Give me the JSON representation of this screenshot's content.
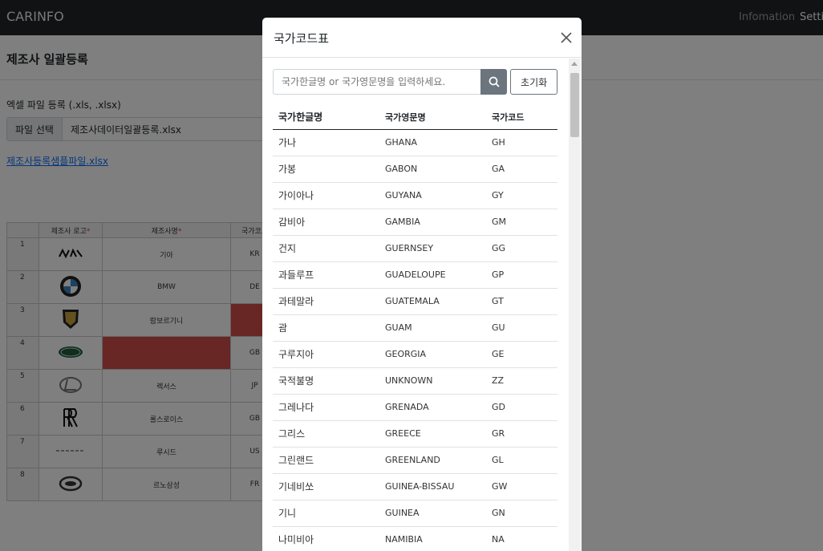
{
  "navbar": {
    "brand": "CARINFO",
    "links": [
      "Infomation",
      "Setti"
    ]
  },
  "page": {
    "title": "제조사 일괄등록",
    "file_label": "엑셀 파일 등록 (.xls, .xlsx)",
    "file_button": "파일 선택",
    "file_name": "제조사데이터일괄등록.xlsx",
    "sample_link": "제조사등록샘플파일.xlsx"
  },
  "grid": {
    "headers": [
      "제조사 로고",
      "제조사명",
      "국가코드"
    ],
    "required_mark": "*",
    "rows": [
      {
        "num": "1",
        "logo": "kia-logo",
        "name": "기아",
        "code": "KR"
      },
      {
        "num": "2",
        "logo": "bmw-logo",
        "name": "BMW",
        "code": "DE"
      },
      {
        "num": "3",
        "logo": "lamborghini-logo",
        "name": "람보르기니",
        "code": ""
      },
      {
        "num": "4",
        "logo": "land-rover-logo",
        "name": "",
        "code": "GB"
      },
      {
        "num": "5",
        "logo": "lexus-logo",
        "name": "렉서스",
        "code": "JP"
      },
      {
        "num": "6",
        "logo": "rolls-royce-logo",
        "name": "롤스로이스",
        "code": "GB"
      },
      {
        "num": "7",
        "logo": "lucid-logo",
        "name": "루시드",
        "code": "US"
      },
      {
        "num": "8",
        "logo": "renault-samsung-logo",
        "name": "르노삼성",
        "code": "FR"
      }
    ],
    "error_color": "#d14d4a"
  },
  "modal": {
    "title": "국가코드표",
    "search_placeholder": "국가한글명 or 국가영문명을 입력하세요.",
    "reset_label": "초기화",
    "columns": [
      "국가한글명",
      "국가영문명",
      "국가코드"
    ],
    "rows": [
      [
        "가나",
        "GHANA",
        "GH"
      ],
      [
        "가봉",
        "GABON",
        "GA"
      ],
      [
        "가이아나",
        "GUYANA",
        "GY"
      ],
      [
        "감비아",
        "GAMBIA",
        "GM"
      ],
      [
        "건지",
        "GUERNSEY",
        "GG"
      ],
      [
        "과들루프",
        "GUADELOUPE",
        "GP"
      ],
      [
        "과테말라",
        "GUATEMALA",
        "GT"
      ],
      [
        "괌",
        "GUAM",
        "GU"
      ],
      [
        "구루지아",
        "GEORGIA",
        "GE"
      ],
      [
        "국적불명",
        "UNKNOWN",
        "ZZ"
      ],
      [
        "그레나다",
        "GRENADA",
        "GD"
      ],
      [
        "그리스",
        "GREECE",
        "GR"
      ],
      [
        "그린랜드",
        "GREENLAND",
        "GL"
      ],
      [
        "기네비쏘",
        "GUINEA-BISSAU",
        "GW"
      ],
      [
        "기니",
        "GUINEA",
        "GN"
      ],
      [
        "나미비아",
        "NAMIBIA",
        "NA"
      ]
    ]
  },
  "icons": {
    "close": "close-icon",
    "search": "search-icon",
    "scroll_up": "chevron-up-icon"
  }
}
